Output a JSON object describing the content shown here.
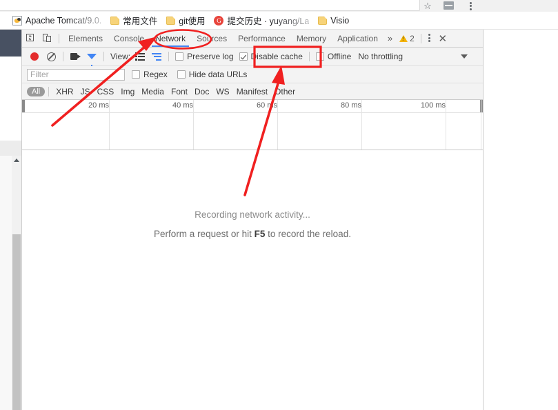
{
  "browser": {
    "star_icon": "star-outline-icon",
    "extension_icon": "extension-icon",
    "menu_icon": "three-dot-menu-icon",
    "bookmarks": [
      {
        "label": "Apache Tomcat/9.0.",
        "icon": "tomcat-favicon",
        "truncated": true
      },
      {
        "label": "常用文件",
        "icon": "folder-icon",
        "truncated": false
      },
      {
        "label": "git使用",
        "icon": "folder-icon",
        "truncated": false
      },
      {
        "label": "提交历史 · yuyang/La",
        "icon": "gitee-favicon",
        "truncated": true
      },
      {
        "label": "Visio",
        "icon": "folder-icon",
        "truncated": false
      }
    ]
  },
  "devtools": {
    "inspect_icon": "inspect-element-icon",
    "device_icon": "device-toolbar-icon",
    "tabs": [
      {
        "label": "Elements",
        "active": false
      },
      {
        "label": "Console",
        "active": false
      },
      {
        "label": "Network",
        "active": true
      },
      {
        "label": "Sources",
        "active": false
      },
      {
        "label": "Performance",
        "active": false
      },
      {
        "label": "Memory",
        "active": false
      },
      {
        "label": "Application",
        "active": false
      }
    ],
    "more_tabs_icon": "chevron-double-right-icon",
    "warning_count": "2",
    "warning_icon": "warning-triangle-icon",
    "settings_icon": "three-dot-menu-icon",
    "close_icon": "close-icon",
    "network_toolbar": {
      "record_icon": "record-button-icon",
      "clear_icon": "clear-icon",
      "camera_icon": "capture-screenshots-icon",
      "funnel_icon": "filter-funnel-icon",
      "view_label": "View:",
      "view_large_rows_icon": "large-request-rows-icon",
      "view_overview_icon": "show-overview-icon",
      "preserve_log": {
        "label": "Preserve log",
        "checked": false
      },
      "disable_cache": {
        "label": "Disable cache",
        "checked": true
      },
      "offline": {
        "label": "Offline",
        "checked": false
      },
      "throttling": {
        "label": "No throttling",
        "caret_icon": "chevron-down-icon"
      }
    },
    "filter_row": {
      "filter_placeholder": "Filter",
      "filter_value": "",
      "regex": {
        "label": "Regex",
        "checked": false
      },
      "hide_data_urls": {
        "label": "Hide data URLs",
        "checked": false
      }
    },
    "type_filters": [
      {
        "label": "All",
        "active": true
      },
      {
        "label": "XHR",
        "active": false
      },
      {
        "label": "JS",
        "active": false
      },
      {
        "label": "CSS",
        "active": false
      },
      {
        "label": "Img",
        "active": false
      },
      {
        "label": "Media",
        "active": false
      },
      {
        "label": "Font",
        "active": false
      },
      {
        "label": "Doc",
        "active": false
      },
      {
        "label": "WS",
        "active": false
      },
      {
        "label": "Manifest",
        "active": false
      },
      {
        "label": "Other",
        "active": false
      }
    ],
    "timeline": {
      "ticks": [
        "20 ms",
        "40 ms",
        "60 ms",
        "80 ms",
        "100 ms"
      ]
    },
    "empty_state": {
      "line1": "Recording network activity...",
      "line2_prefix": "Perform a request or hit ",
      "line2_key": "F5",
      "line2_suffix": " to record the reload."
    }
  },
  "annotations": {
    "color": "#f02020",
    "ellipse_target": "Network",
    "rect_target": "Disable cache",
    "arrow_1_target": "Network",
    "arrow_2_target": "Disable cache"
  }
}
